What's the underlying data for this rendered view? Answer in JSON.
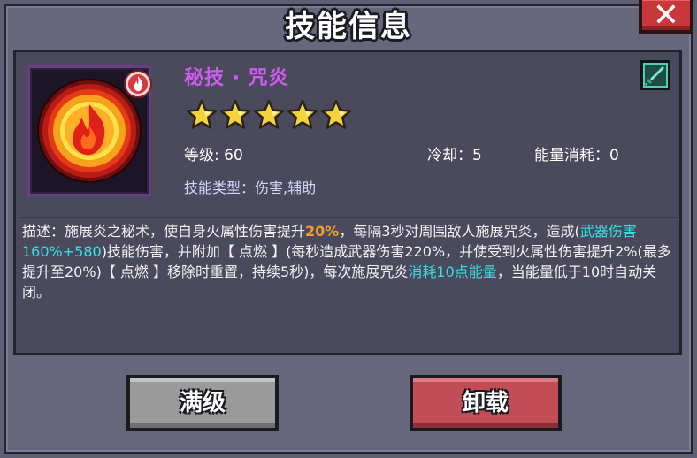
{
  "dialog": {
    "title": "技能信息",
    "close_label": "✕"
  },
  "skill": {
    "name": "秘技 · 咒炎",
    "rating_stars": 5,
    "level_label": "等级: 60",
    "cooldown_label": "冷却：5",
    "energy_cost_label": "能量消耗：0",
    "type_label": "技能类型：伤害,辅助",
    "icon": "flame-orb-icon",
    "badge_icon": "fire-element-badge-icon",
    "weapon_icon": "sword-weapon-icon"
  },
  "description": {
    "p1": "描述：施展炎之秘术，使自身火属性伤害提升",
    "p2": "20%",
    "p3": "，每隔3秒对周围敌人施展咒炎，造成(",
    "p4": "武器伤害160%+580",
    "p5": ")技能伤害，并附加【 点燃 】(每秒造成武器伤害220%，并使受到火属性伤害提升2%(最多提升至20%)【 点燃 】移除时重置，持续5秒)，每次施展咒炎",
    "p6": "消耗10点能量",
    "p7": "，当能量低于10时自动关闭。"
  },
  "buttons": {
    "max_label": "满级",
    "unload_label": "卸载"
  },
  "colors": {
    "skill_name": "#cc5cf0",
    "highlight_orange": "#f59b2a",
    "highlight_cyan": "#35e0e4",
    "unload_button": "#c24d57",
    "max_button": "#9a9a9a"
  }
}
